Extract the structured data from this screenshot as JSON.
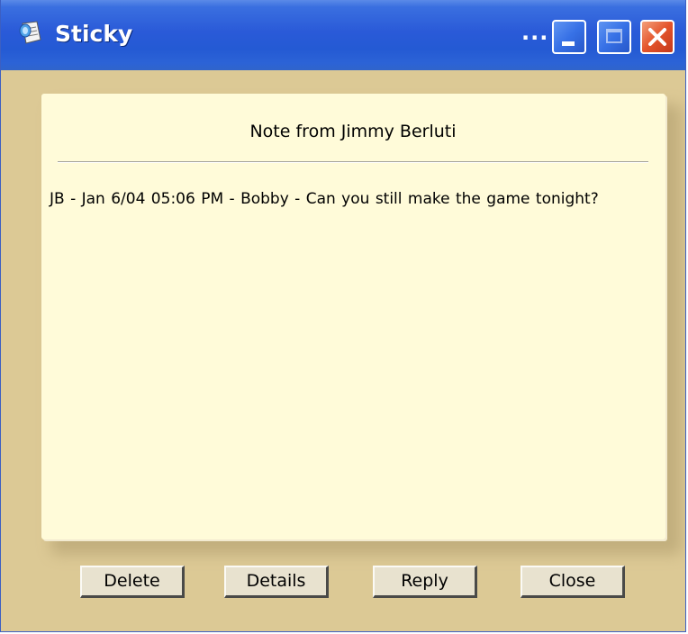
{
  "window": {
    "title": "Sticky",
    "title_ellipsis": "...",
    "controls": {
      "minimize_icon": "minimize-icon",
      "maximize_icon": "maximize-icon",
      "close_icon": "close-icon"
    }
  },
  "note": {
    "title": "Note from Jimmy Berluti",
    "message": "JB - Jan 6/04 05:06 PM - Bobby - Can you still make the game tonight?"
  },
  "actions": {
    "delete_label": "Delete",
    "details_label": "Details",
    "reply_label": "Reply",
    "close_label": "Close"
  },
  "colors": {
    "titlebar": "#245ad4",
    "window_background": "#dcc995",
    "note_background": "#fffbd9",
    "close_button": "#e4542b"
  }
}
